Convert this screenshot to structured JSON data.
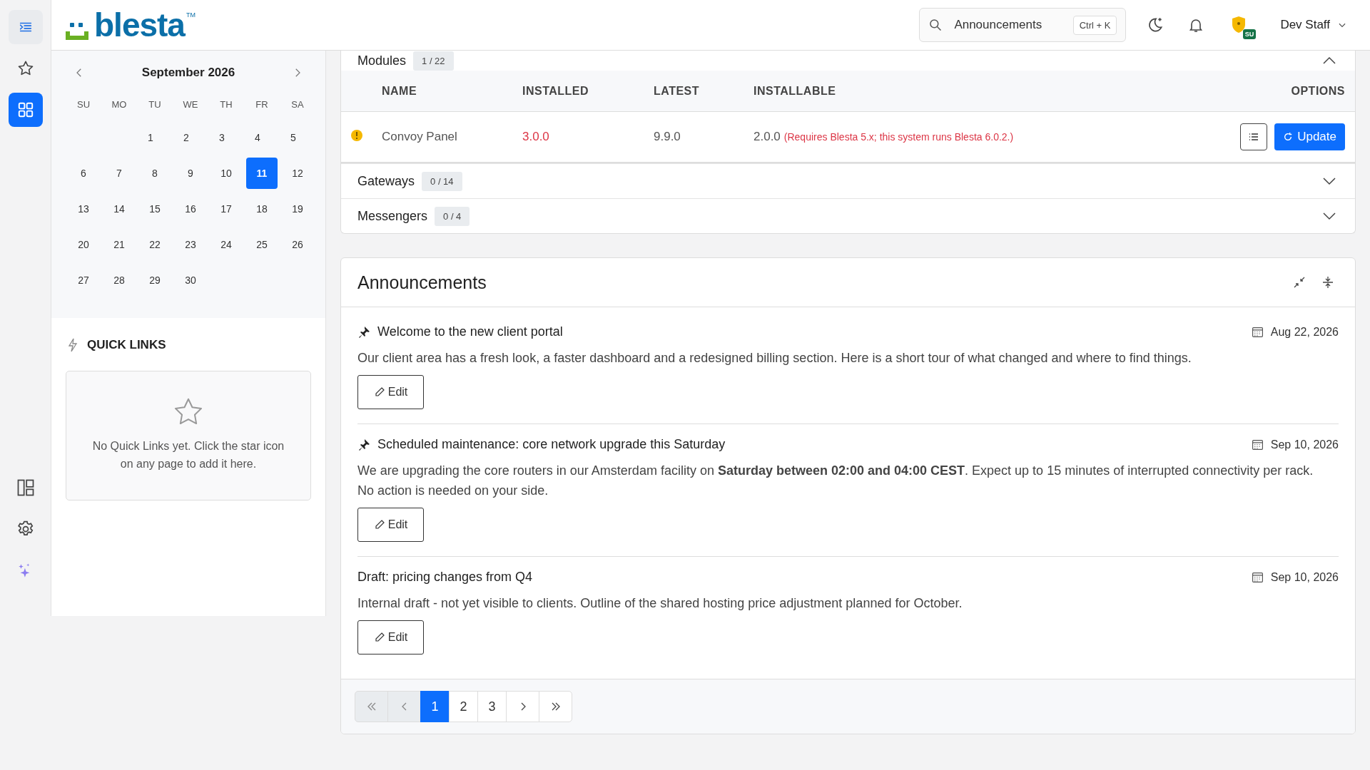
{
  "rail": [
    {
      "kind": "indent",
      "selected": false
    },
    {
      "kind": "star",
      "selected": false
    },
    {
      "kind": "grid",
      "selected": true
    },
    {
      "kind": "layout",
      "selected": false
    },
    {
      "kind": "gear",
      "selected": false
    },
    {
      "kind": "sparkle",
      "selected": false
    }
  ],
  "header": {
    "logo": "blesta",
    "logo_mark": "TM",
    "search": {
      "placeholder": "Announcements",
      "shortcut": "Ctrl + K"
    },
    "role_badge": "SU",
    "user": "Dev Staff"
  },
  "calendar": {
    "month": "September 2026",
    "weekdays": [
      "SU",
      "MO",
      "TU",
      "WE",
      "TH",
      "FR",
      "SA"
    ],
    "weeks": [
      [
        {
          "day": "1",
          "selected": false
        },
        {
          "day": "2",
          "selected": false
        },
        {
          "day": "3",
          "selected": false
        },
        {
          "day": "4",
          "selected": false
        },
        {
          "day": "5",
          "selected": false
        }
      ],
      [
        {
          "day": "6",
          "selected": false
        },
        {
          "day": "7",
          "selected": false
        },
        {
          "day": "8",
          "selected": false
        },
        {
          "day": "9",
          "selected": false
        },
        {
          "day": "10",
          "selected": false
        },
        {
          "day": "11",
          "selected": true
        },
        {
          "day": "12",
          "selected": false
        }
      ],
      [
        {
          "day": "13",
          "selected": false
        },
        {
          "day": "14",
          "selected": false
        },
        {
          "day": "15",
          "selected": false
        },
        {
          "day": "16",
          "selected": false
        },
        {
          "day": "17",
          "selected": false
        },
        {
          "day": "18",
          "selected": false
        },
        {
          "day": "19",
          "selected": false
        }
      ],
      [
        {
          "day": "20",
          "selected": false
        },
        {
          "day": "21",
          "selected": false
        },
        {
          "day": "22",
          "selected": false
        },
        {
          "day": "23",
          "selected": false
        },
        {
          "day": "24",
          "selected": false
        },
        {
          "day": "25",
          "selected": false
        },
        {
          "day": "26",
          "selected": false
        }
      ],
      [
        {
          "day": "27",
          "selected": false
        },
        {
          "day": "28",
          "selected": false
        },
        {
          "day": "29",
          "selected": false
        },
        {
          "day": "30",
          "selected": false
        }
      ]
    ]
  },
  "quick_links": {
    "title": "QUICK LINKS",
    "empty_text": "No Quick Links yet. Click the star icon on any page to add it here."
  },
  "extension_groups": [
    {
      "name": "Modules",
      "count": "1 / 22",
      "expanded": true,
      "columns": [
        "NAME",
        "INSTALLED",
        "LATEST",
        "INSTALLABLE",
        "OPTIONS"
      ],
      "rows": [
        {
          "warning": true,
          "name": "Convoy Panel",
          "installed": "3.0.0",
          "latest": "9.9.0",
          "installable": "2.0.0",
          "note": "(Requires Blesta 5.x; this system runs Blesta 6.0.2.)",
          "action": "Update"
        }
      ]
    },
    {
      "name": "Gateways",
      "count": "0 / 14",
      "expanded": false
    },
    {
      "name": "Messengers",
      "count": "0 / 4",
      "expanded": false
    }
  ],
  "announcements": {
    "title": "Announcements",
    "items": [
      {
        "pinned": true,
        "title": "Welcome to the new client portal",
        "date": "Aug 22, 2026",
        "body": "Our client area has a fresh look, a faster dashboard and a redesigned billing section. Here is a short tour of what changed and where to find things.",
        "edit": "Edit"
      },
      {
        "pinned": true,
        "title": "Scheduled maintenance: core network upgrade this Saturday",
        "date": "Sep 10, 2026",
        "body": "We are upgrading the core routers in our Amsterdam facility on **Saturday between 02:00 and 04:00 CEST**. Expect up to 15 minutes of interrupted connectivity per rack. No action is needed on your side.",
        "edit": "Edit"
      },
      {
        "pinned": false,
        "title": "Draft: pricing changes from Q4",
        "date": "Sep 10, 2026",
        "body": "Internal draft - not yet visible to clients. Outline of the shared hosting price adjustment planned for October.",
        "edit": "Edit"
      }
    ],
    "pages": [
      {
        "kind": "first"
      },
      {
        "kind": "prev"
      },
      {
        "kind": "number",
        "label": "1",
        "selected": true
      },
      {
        "kind": "number",
        "label": "2",
        "selected": false
      },
      {
        "kind": "number",
        "label": "3",
        "selected": false
      },
      {
        "kind": "next"
      },
      {
        "kind": "last"
      }
    ]
  }
}
